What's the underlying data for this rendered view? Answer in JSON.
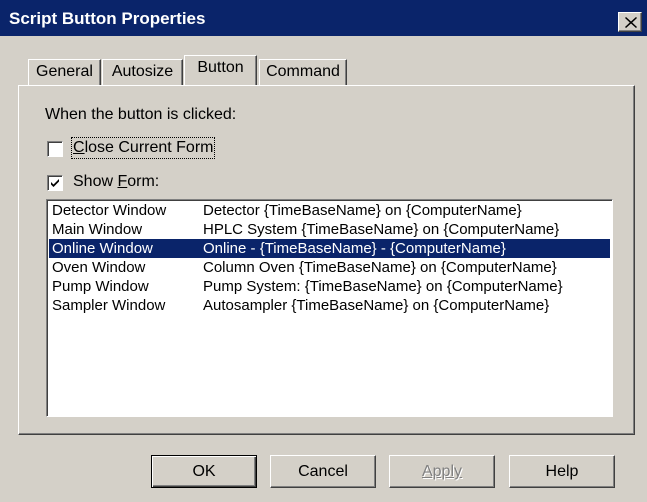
{
  "window": {
    "title": "Script Button Properties",
    "close_icon": "close-icon"
  },
  "tabs": [
    {
      "label": "General",
      "active": false
    },
    {
      "label": "Autosize",
      "active": false
    },
    {
      "label": "Button",
      "active": true
    },
    {
      "label": "Command",
      "active": false
    }
  ],
  "panel": {
    "prompt": "When the button is clicked:",
    "close_current_form": {
      "label": "Close Current Form",
      "checked": false
    },
    "show_form": {
      "label": "Show Form:",
      "checked": true
    }
  },
  "form_list": {
    "selected_index": 2,
    "rows": [
      {
        "name": "Detector Window",
        "title": "Detector {TimeBaseName} on {ComputerName}"
      },
      {
        "name": "Main Window",
        "title": "HPLC System {TimeBaseName} on {ComputerName}"
      },
      {
        "name": "Online Window",
        "title": "Online - {TimeBaseName} - {ComputerName}"
      },
      {
        "name": "Oven Window",
        "title": "Column Oven {TimeBaseName} on {ComputerName}"
      },
      {
        "name": "Pump Window",
        "title": "Pump System: {TimeBaseName} on {ComputerName}"
      },
      {
        "name": "Sampler Window",
        "title": "Autosampler {TimeBaseName} on {ComputerName}"
      }
    ]
  },
  "buttons": {
    "ok": "OK",
    "cancel": "Cancel",
    "apply": "Apply",
    "help": "Help"
  },
  "colors": {
    "titlebar": "#0a246a",
    "face": "#d4d0c8",
    "selection": "#0a246a"
  }
}
